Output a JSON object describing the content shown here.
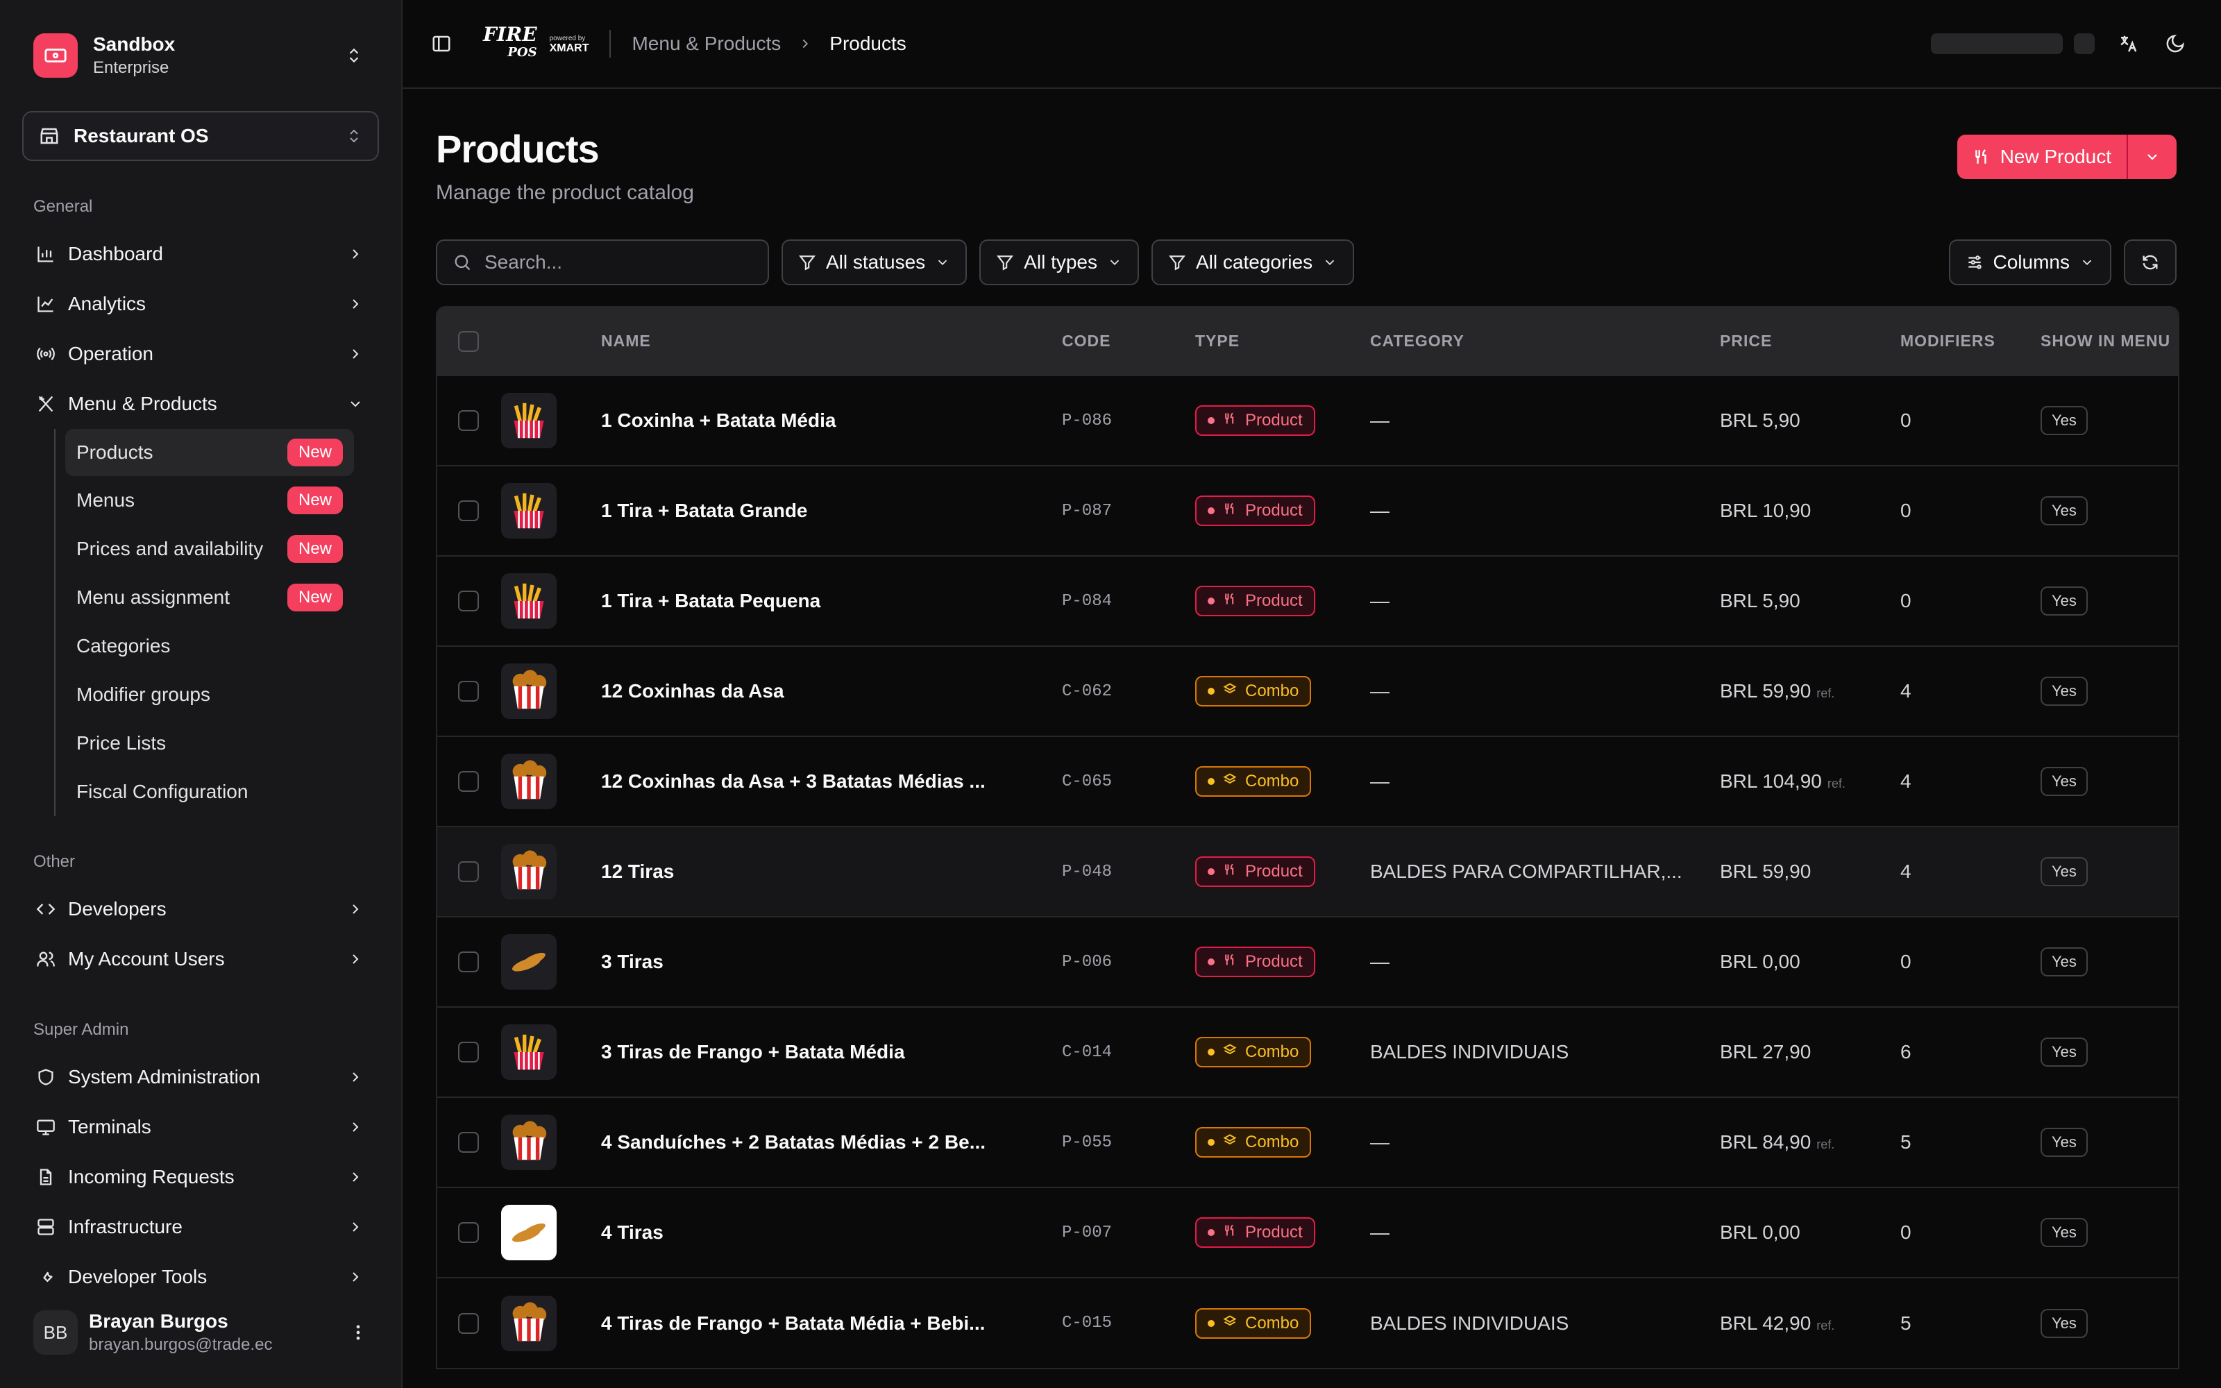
{
  "org": {
    "name": "Sandbox",
    "plan": "Enterprise"
  },
  "workspace": {
    "label": "Restaurant OS"
  },
  "sidebar": {
    "general_title": "General",
    "general": [
      {
        "label": "Dashboard",
        "icon": "bar-chart-icon"
      },
      {
        "label": "Analytics",
        "icon": "line-chart-icon"
      },
      {
        "label": "Operation",
        "icon": "radio-icon"
      },
      {
        "label": "Menu & Products",
        "icon": "utensils-icon"
      }
    ],
    "menu_sub": [
      {
        "label": "Products",
        "badge": "New"
      },
      {
        "label": "Menus",
        "badge": "New"
      },
      {
        "label": "Prices and availability",
        "badge": "New"
      },
      {
        "label": "Menu assignment",
        "badge": "New"
      },
      {
        "label": "Categories"
      },
      {
        "label": "Modifier groups"
      },
      {
        "label": "Price Lists"
      },
      {
        "label": "Fiscal Configuration"
      }
    ],
    "other_title": "Other",
    "other": [
      {
        "label": "Developers",
        "icon": "code-icon"
      },
      {
        "label": "My Account Users",
        "icon": "users-icon"
      }
    ],
    "super_title": "Super Admin",
    "super": [
      {
        "label": "System Administration",
        "icon": "shield-icon"
      },
      {
        "label": "Terminals",
        "icon": "terminal-icon"
      },
      {
        "label": "Incoming Requests",
        "icon": "file-icon"
      },
      {
        "label": "Infrastructure",
        "icon": "server-icon"
      },
      {
        "label": "Developer Tools",
        "icon": "wrench-icon"
      }
    ]
  },
  "user": {
    "initials": "BB",
    "name": "Brayan Burgos",
    "email": "brayan.burgos@trade.ec"
  },
  "topbar": {
    "brand_fire": "FIRE",
    "brand_pos": "POS",
    "brand_powered": "powered by",
    "brand_xmart": "XMART",
    "crumbs": [
      "Menu & Products",
      "Products"
    ]
  },
  "page": {
    "title": "Products",
    "subtitle": "Manage the product catalog",
    "new_button": "New Product"
  },
  "toolbar": {
    "search_placeholder": "Search...",
    "filter_status": "All statuses",
    "filter_type": "All types",
    "filter_category": "All categories",
    "columns": "Columns"
  },
  "table": {
    "headers": [
      "NAME",
      "CODE",
      "TYPE",
      "CATEGORY",
      "PRICE",
      "MODIFIERS",
      "SHOW IN MENU"
    ],
    "rows": [
      {
        "name": "1 Coxinha + Batata Média",
        "code": "P-086",
        "type": "Product",
        "category": "—",
        "price": "BRL 5,90",
        "ref": "",
        "modifiers": "0",
        "show": "Yes"
      },
      {
        "name": "1 Tira + Batata Grande",
        "code": "P-087",
        "type": "Product",
        "category": "—",
        "price": "BRL 10,90",
        "ref": "",
        "modifiers": "0",
        "show": "Yes"
      },
      {
        "name": "1 Tira + Batata Pequena",
        "code": "P-084",
        "type": "Product",
        "category": "—",
        "price": "BRL 5,90",
        "ref": "",
        "modifiers": "0",
        "show": "Yes"
      },
      {
        "name": "12 Coxinhas da Asa",
        "code": "C-062",
        "type": "Combo",
        "category": "—",
        "price": "BRL 59,90",
        "ref": "ref.",
        "modifiers": "4",
        "show": "Yes"
      },
      {
        "name": "12 Coxinhas da Asa + 3 Batatas Médias ...",
        "code": "C-065",
        "type": "Combo",
        "category": "—",
        "price": "BRL 104,90",
        "ref": "ref.",
        "modifiers": "4",
        "show": "Yes"
      },
      {
        "name": "12 Tiras",
        "code": "P-048",
        "type": "Product",
        "category": "BALDES PARA COMPARTILHAR,...",
        "price": "BRL 59,90",
        "ref": "",
        "modifiers": "4",
        "show": "Yes"
      },
      {
        "name": "3 Tiras",
        "code": "P-006",
        "type": "Product",
        "category": "—",
        "price": "BRL 0,00",
        "ref": "",
        "modifiers": "0",
        "show": "Yes"
      },
      {
        "name": "3 Tiras de Frango + Batata Média",
        "code": "C-014",
        "type": "Combo",
        "category": "BALDES INDIVIDUAIS",
        "price": "BRL 27,90",
        "ref": "",
        "modifiers": "6",
        "show": "Yes"
      },
      {
        "name": "4 Sanduíches + 2 Batatas Médias + 2 Be...",
        "code": "P-055",
        "type": "Combo",
        "category": "—",
        "price": "BRL 84,90",
        "ref": "ref.",
        "modifiers": "5",
        "show": "Yes"
      },
      {
        "name": "4 Tiras",
        "code": "P-007",
        "type": "Product",
        "category": "—",
        "price": "BRL 0,00",
        "ref": "",
        "modifiers": "0",
        "show": "Yes"
      },
      {
        "name": "4 Tiras de Frango + Batata Média + Bebi...",
        "code": "C-015",
        "type": "Combo",
        "category": "BALDES INDIVIDUAIS",
        "price": "BRL 42,90",
        "ref": "ref.",
        "modifiers": "5",
        "show": "Yes"
      }
    ]
  },
  "colors": {
    "accent": "#f43f5e",
    "product": "#fb7185",
    "combo": "#fbbf24"
  }
}
